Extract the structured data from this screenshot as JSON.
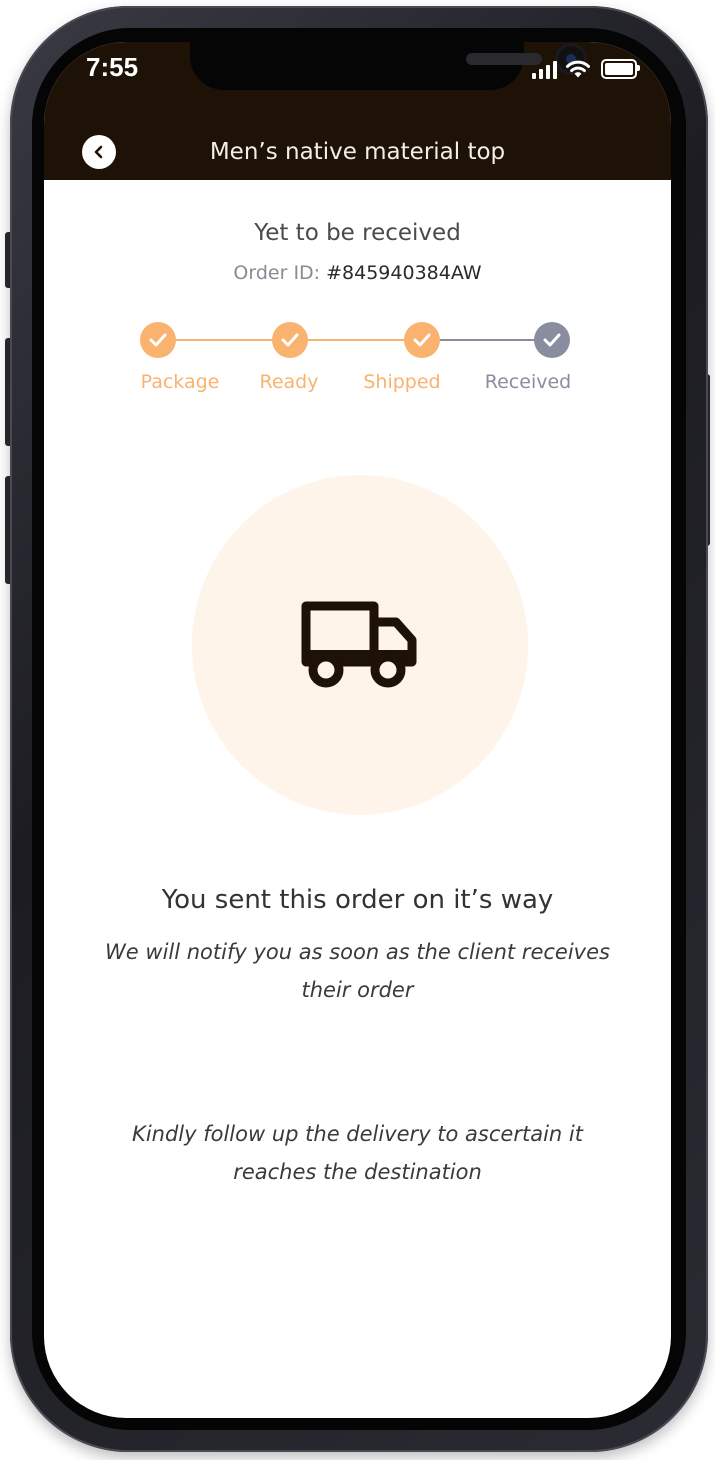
{
  "status_bar": {
    "time": "7:55"
  },
  "header": {
    "title": "Men’s native material top",
    "back_icon": "chevron-left-icon"
  },
  "order": {
    "status": "Yet to be received",
    "id_label": "Order ID:",
    "id_value": "#845940384AW"
  },
  "steps": [
    {
      "label": "Package",
      "complete": true
    },
    {
      "label": "Ready",
      "complete": true
    },
    {
      "label": "Shipped",
      "complete": true
    },
    {
      "label": "Received",
      "complete": false
    }
  ],
  "illustration": {
    "icon": "delivery-truck-icon"
  },
  "message": {
    "headline": "You sent this order on it’s way",
    "subtext": "We will notify you as soon as the client receives their order",
    "note": "Kindly follow up the delivery to ascertain it reaches the destination"
  },
  "colors": {
    "header_bg": "#1e1106",
    "accent": "#f9b36f",
    "pending": "#8a8ca0",
    "illustration_bg": "#fff4ea"
  }
}
